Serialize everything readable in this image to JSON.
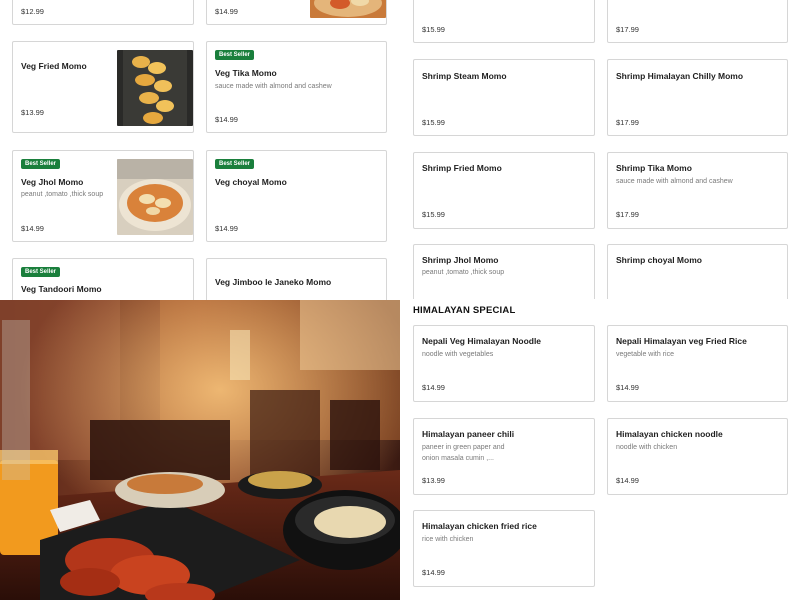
{
  "left_menu": {
    "top_left_price": "$12.99",
    "top_mid_price": "$14.99",
    "items": [
      {
        "name": "Veg Fried Momo",
        "desc": "",
        "price": "$13.99",
        "badge": "",
        "image": "fried-momo-photo"
      },
      {
        "name": "Veg Tika Momo",
        "desc": "sauce made with almond and cashew",
        "price": "$14.99",
        "badge": "Best Seller",
        "image": ""
      },
      {
        "name": "Veg Jhol Momo",
        "desc": "peanut ,tomato ,thick soup",
        "price": "$14.99",
        "badge": "Best Seller",
        "image": "jhol-momo-photo"
      },
      {
        "name": "Veg choyal Momo",
        "desc": "",
        "price": "$14.99",
        "badge": "Best Seller",
        "image": ""
      },
      {
        "name": "Veg Tandoori Momo",
        "desc": "",
        "price": "",
        "badge": "Best Seller",
        "image": ""
      },
      {
        "name": "Veg Jimboo le Janeko Momo",
        "desc": "",
        "price": "",
        "badge": "",
        "image": ""
      }
    ]
  },
  "right_menu": {
    "top_prices": [
      "$15.99",
      "$17.99"
    ],
    "items": [
      {
        "name": "Shrimp Steam Momo",
        "desc": "",
        "price": "$15.99"
      },
      {
        "name": "Shrimp Himalayan Chilly Momo",
        "desc": "",
        "price": "$17.99"
      },
      {
        "name": "Shrimp Fried Momo",
        "desc": "",
        "price": "$15.99"
      },
      {
        "name": "Shrimp Tika Momo",
        "desc": "sauce made with almond and cashew",
        "price": "$17.99"
      },
      {
        "name": "Shrimp Jhol Momo",
        "desc": "peanut ,tomato ,thick soup",
        "price": ""
      },
      {
        "name": "Shrimp choyal Momo",
        "desc": "",
        "price": ""
      }
    ]
  },
  "himalayan_special": {
    "title": "HIMALAYAN SPECIAL",
    "items": [
      {
        "name": "Nepali Veg Himalayan Noodle",
        "desc": "noodle with vegetables",
        "price": "$14.99"
      },
      {
        "name": "Nepali Himalayan veg Fried Rice",
        "desc": "vegetable with rice",
        "price": "$14.99"
      },
      {
        "name": "Himalayan paneer chili",
        "desc": "paneer in green paper and onion masala cumin ,...",
        "price": "$13.99"
      },
      {
        "name": "Himalayan chicken noodle",
        "desc": "noodle with chicken",
        "price": "$14.99"
      },
      {
        "name": "Himalayan chicken fried rice",
        "desc": "rice with chicken",
        "price": "$14.99"
      }
    ]
  },
  "hero": {
    "image": "restaurant-dining-photo"
  },
  "colors": {
    "badge": "#1a7f3c",
    "border": "#d6d6d6",
    "text": "#1f1f1f",
    "muted": "#7a7a7a"
  }
}
